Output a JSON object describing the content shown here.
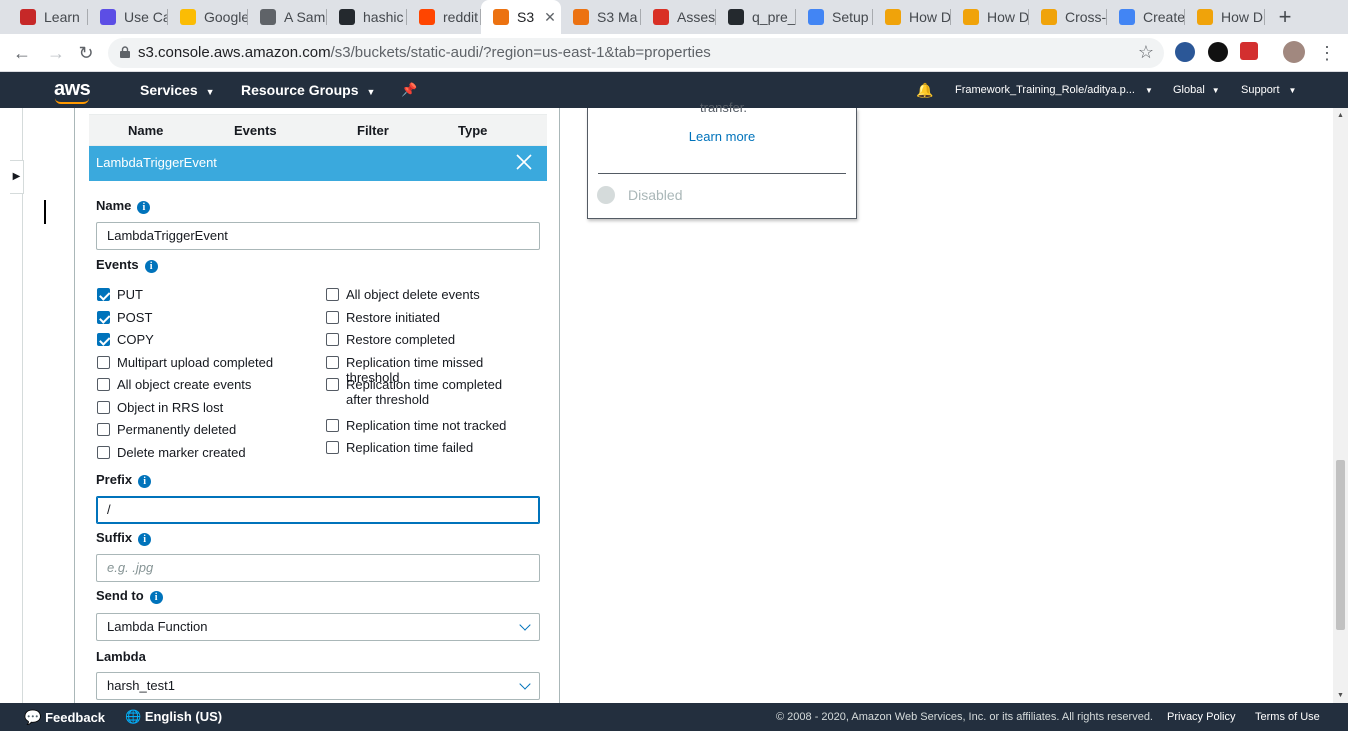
{
  "browser": {
    "tabs": [
      {
        "title": "Learn",
        "color": "#c62828"
      },
      {
        "title": "Use Ca",
        "color": "#5c4ee5"
      },
      {
        "title": "Google",
        "color": "#fbbc04"
      },
      {
        "title": "A Sam",
        "color": "#5f6368"
      },
      {
        "title": "hashic",
        "color": "#24292e"
      },
      {
        "title": "reddit",
        "color": "#ff4500"
      },
      {
        "title": "S3",
        "color": "#ec7211",
        "active": true
      },
      {
        "title": "S3 Ma",
        "color": "#ec7211"
      },
      {
        "title": "Assess",
        "color": "#d93025"
      },
      {
        "title": "q_pre_",
        "color": "#24292e"
      },
      {
        "title": "Setup",
        "color": "#4285f4"
      },
      {
        "title": "How D",
        "color": "#f0a30a"
      },
      {
        "title": "How D",
        "color": "#f0a30a"
      },
      {
        "title": "Cross-",
        "color": "#f0a30a"
      },
      {
        "title": "Create",
        "color": "#4285f4"
      },
      {
        "title": "How D",
        "color": "#f0a30a"
      }
    ],
    "url_host": "s3.console.aws.amazon.com",
    "url_path": "/s3/buckets/static-audi/?region=us-east-1&tab=properties"
  },
  "aws_header": {
    "logo": "aws",
    "services": "Services",
    "resource_groups": "Resource Groups",
    "account": "Framework_Training_Role/aditya.p...",
    "region": "Global",
    "support": "Support"
  },
  "events_table": {
    "headers": [
      "Name",
      "Events",
      "Filter",
      "Type"
    ],
    "selected_name": "LambdaTriggerEvent"
  },
  "form": {
    "name_label": "Name",
    "name_value": "LambdaTriggerEvent",
    "events_label": "Events",
    "events_left": [
      {
        "label": "PUT",
        "checked": true
      },
      {
        "label": "POST",
        "checked": true
      },
      {
        "label": "COPY",
        "checked": true
      },
      {
        "label": "Multipart upload completed",
        "checked": false
      },
      {
        "label": "All object create events",
        "checked": false
      },
      {
        "label": "Object in RRS lost",
        "checked": false
      },
      {
        "label": "Permanently deleted",
        "checked": false
      },
      {
        "label": "Delete marker created",
        "checked": false
      }
    ],
    "events_right": [
      {
        "label": "All object delete events",
        "checked": false
      },
      {
        "label": "Restore initiated",
        "checked": false
      },
      {
        "label": "Restore completed",
        "checked": false
      },
      {
        "label": "Replication time missed threshold",
        "checked": false
      },
      {
        "label": "Replication time completed after threshold",
        "checked": false
      },
      {
        "label": "Replication time not tracked",
        "checked": false
      },
      {
        "label": "Replication time failed",
        "checked": false
      }
    ],
    "prefix_label": "Prefix",
    "prefix_value": "/",
    "suffix_label": "Suffix",
    "suffix_placeholder": "e.g. .jpg",
    "send_to_label": "Send to",
    "send_to_value": "Lambda Function",
    "lambda_label": "Lambda",
    "lambda_value": "harsh_test1"
  },
  "side_card": {
    "transfer_text": "transfer.",
    "learn_more": "Learn more",
    "status": "Disabled"
  },
  "footer": {
    "feedback": "Feedback",
    "language": "English (US)",
    "copyright": "© 2008 - 2020, Amazon Web Services, Inc. or its affiliates. All rights reserved.",
    "privacy": "Privacy Policy",
    "terms": "Terms of Use"
  },
  "colors": {
    "aws_nav": "#232f3e",
    "selected_row": "#3aa9dd",
    "link": "#0073bb"
  }
}
